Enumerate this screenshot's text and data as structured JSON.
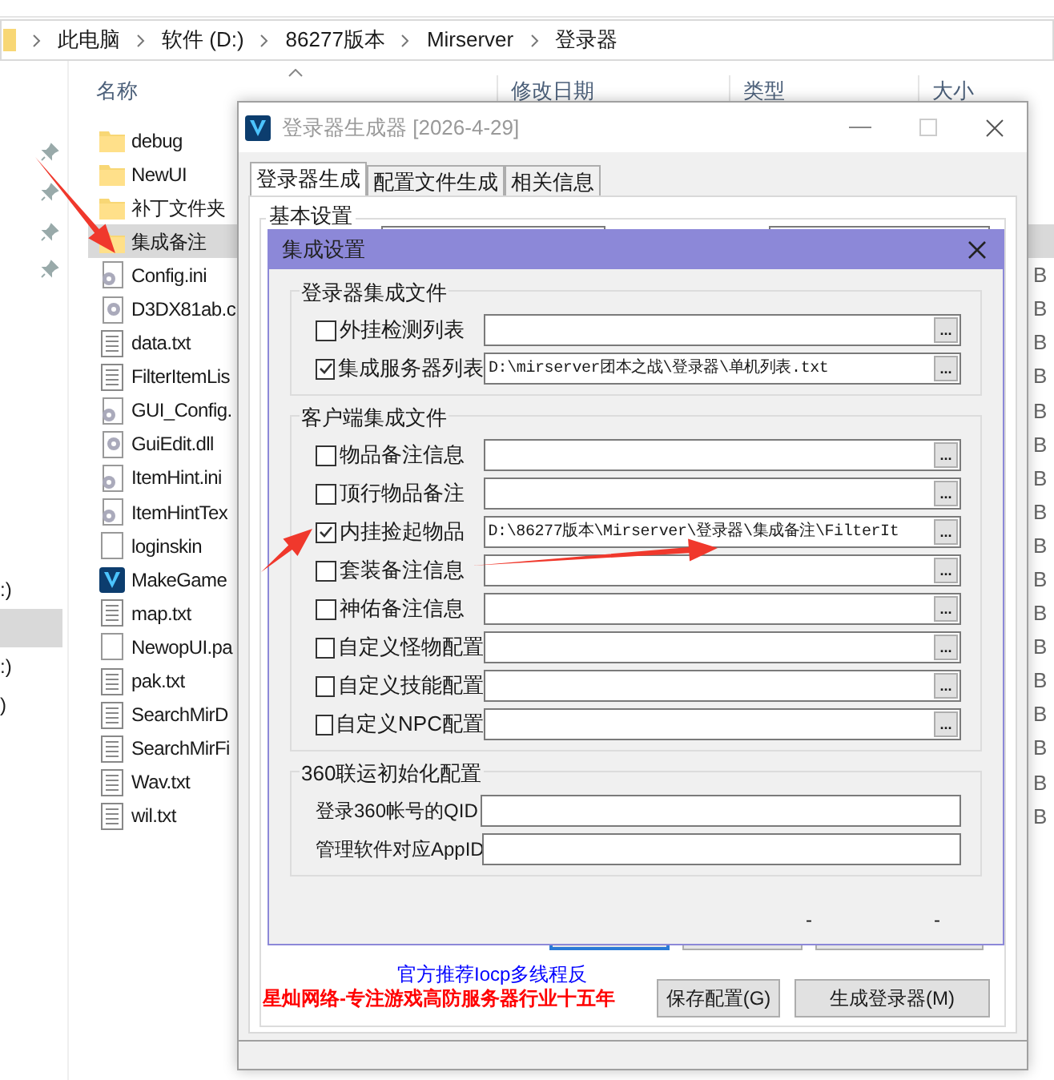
{
  "explorer": {
    "breadcrumbs": [
      "此电脑",
      "软件 (D:)",
      "86277版本",
      "Mirserver",
      "登录器"
    ],
    "columns": [
      "名称",
      "修改日期",
      "类型",
      "大小"
    ],
    "nav_items": [
      {
        "label": ":)",
        "selected": false
      },
      {
        "selected": true
      },
      {
        "label": ":)",
        "selected": false
      },
      {
        "label": ")",
        "selected": false
      }
    ],
    "files": [
      {
        "name": "debug",
        "kind": "folder",
        "selected": false
      },
      {
        "name": "NewUI",
        "kind": "folder",
        "selected": false
      },
      {
        "name": "补丁文件夹",
        "kind": "folder",
        "selected": false
      },
      {
        "name": "集成备注",
        "kind": "folder",
        "selected": true
      },
      {
        "name": "Config.ini",
        "kind": "config",
        "selected": false,
        "size": "B"
      },
      {
        "name": "D3DX81ab.c",
        "kind": "dll",
        "selected": false,
        "size": "B"
      },
      {
        "name": "data.txt",
        "kind": "text",
        "selected": false,
        "size": "B"
      },
      {
        "name": "FilterItemLis",
        "kind": "text",
        "selected": false,
        "size": "B"
      },
      {
        "name": "GUI_Config.",
        "kind": "config",
        "selected": false,
        "size": "B"
      },
      {
        "name": "GuiEdit.dll",
        "kind": "dll",
        "selected": false,
        "size": "B"
      },
      {
        "name": "ItemHint.ini",
        "kind": "config",
        "selected": false,
        "size": "B"
      },
      {
        "name": "ItemHintTex",
        "kind": "config",
        "selected": false,
        "size": "B"
      },
      {
        "name": "loginskin",
        "kind": "blank",
        "selected": false,
        "size": "B"
      },
      {
        "name": "MakeGame",
        "kind": "app",
        "selected": false,
        "size": "B"
      },
      {
        "name": "map.txt",
        "kind": "text",
        "selected": false,
        "size": "B"
      },
      {
        "name": "NewopUI.pa",
        "kind": "blank",
        "selected": false,
        "size": "B"
      },
      {
        "name": "pak.txt",
        "kind": "text",
        "selected": false,
        "size": "B"
      },
      {
        "name": "SearchMirD",
        "kind": "text",
        "selected": false,
        "size": "B"
      },
      {
        "name": "SearchMirFi",
        "kind": "text",
        "selected": false,
        "size": "B"
      },
      {
        "name": "Wav.txt",
        "kind": "text",
        "selected": false,
        "size": "B"
      },
      {
        "name": "wil.txt",
        "kind": "text",
        "selected": false,
        "size": "B"
      }
    ]
  },
  "main_window": {
    "title": "登录器生成器 [2026-4-29]",
    "tabs": [
      {
        "label": "登录器生成",
        "selected": true
      },
      {
        "label": "配置文件生成",
        "selected": false
      },
      {
        "label": "相关信息",
        "selected": false
      }
    ],
    "group_title": "基本设置",
    "notice": "官方推荐Iocp多线程反",
    "slogan": "星灿网络-专注游戏高防服务器行业十五年",
    "buttons": [
      "保存配置(G)",
      "生成登录器(M)"
    ]
  },
  "dialog": {
    "title": "集成设置",
    "groups": [
      {
        "title": "登录器集成文件",
        "rows": [
          {
            "kind": "file",
            "label": "外挂检测列表",
            "checked": false,
            "button": "..."
          },
          {
            "kind": "file",
            "label": "集成服务器列表",
            "checked": true,
            "value": "D:\\mirserver团本之战\\登录器\\单机列表.txt",
            "button": "..."
          }
        ]
      },
      {
        "title": "客户端集成文件",
        "rows": [
          {
            "kind": "file",
            "label": "物品备注信息",
            "checked": false,
            "button": "..."
          },
          {
            "kind": "file",
            "label": "顶行物品备注",
            "checked": false,
            "button": "..."
          },
          {
            "kind": "file",
            "label": "内挂捡起物品",
            "checked": true,
            "value": "D:\\86277版本\\Mirserver\\登录器\\集成备注\\FilterIt",
            "button": "..."
          },
          {
            "kind": "file",
            "label": "套装备注信息",
            "checked": false,
            "button": "..."
          },
          {
            "kind": "file",
            "label": "神佑备注信息",
            "checked": false,
            "button": "..."
          },
          {
            "kind": "file",
            "label": "自定义怪物配置",
            "checked": false,
            "button": "..."
          },
          {
            "kind": "file",
            "label": "自定义技能配置",
            "checked": false,
            "button": "..."
          },
          {
            "kind": "file",
            "label": "自定义NPC配置",
            "checked": false,
            "button": "..."
          }
        ]
      },
      {
        "title": "360联运初始化配置",
        "rows": [
          {
            "kind": "text",
            "label": "登录360帐号的QID"
          },
          {
            "kind": "text",
            "label": "管理软件对应AppID"
          }
        ]
      }
    ],
    "marks": [
      "-",
      "-"
    ]
  }
}
